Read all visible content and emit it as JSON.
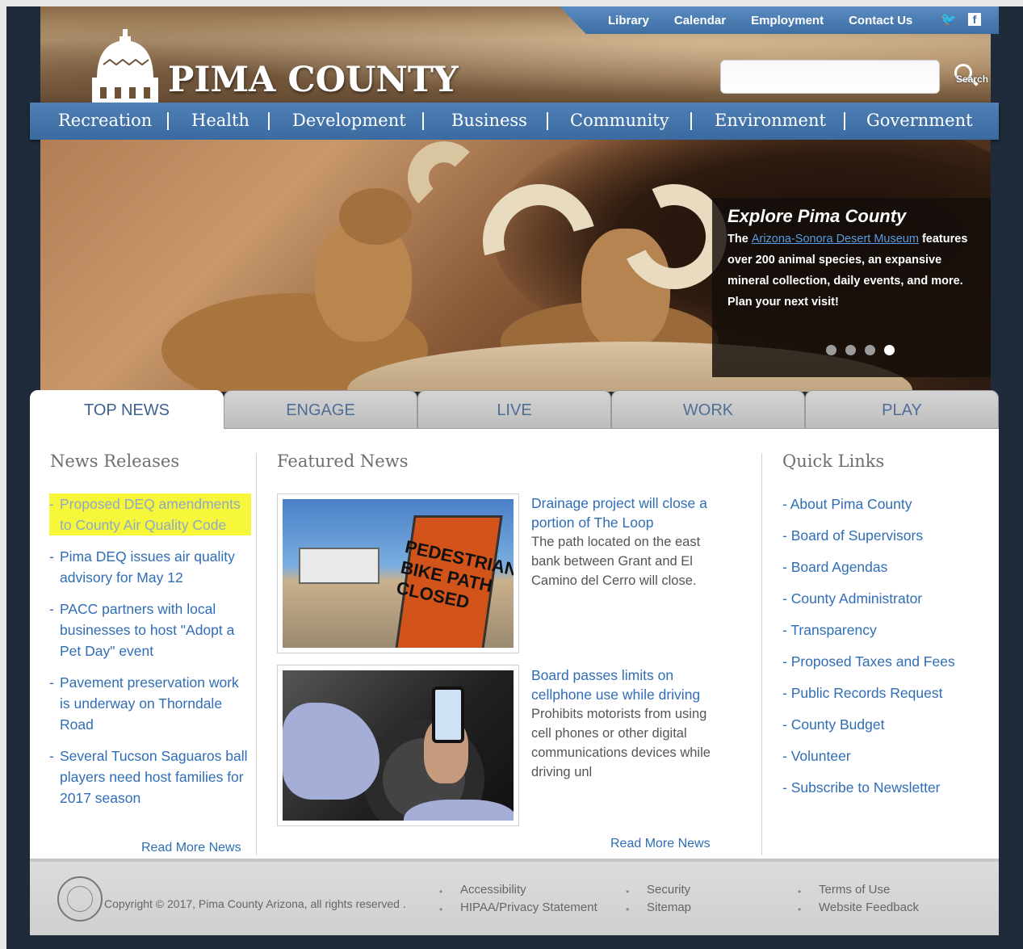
{
  "utility_nav": [
    "Library",
    "Calendar",
    "Employment",
    "Contact Us"
  ],
  "logo_text": "PIMA COUNTY",
  "search": {
    "placeholder": "",
    "button_label": "Search"
  },
  "main_nav": [
    "Recreation",
    "Health",
    "Development",
    "Business",
    "Community",
    "Environment",
    "Government"
  ],
  "hero": {
    "title": "Explore Pima County",
    "text_prefix": "The ",
    "link_text": "Arizona-Sonora Desert Museum",
    "text_suffix": " features over 200 animal species, an expansive mineral collection, daily events, and more. Plan your next visit!",
    "slide_count": 4,
    "active_slide": 4
  },
  "tabs": [
    "TOP NEWS",
    "ENGAGE",
    "LIVE",
    "WORK",
    "PLAY"
  ],
  "active_tab": "TOP NEWS",
  "news_releases": {
    "heading": "News Releases",
    "items": [
      "Proposed DEQ amendments to County Air Quality Code",
      "Pima DEQ issues air quality advisory for May 12",
      "PACC partners with local businesses to host \"Adopt a Pet Day\" event",
      "Pavement preservation work is underway on Thorndale Road",
      "Several Tucson Saguaros ball players need host families for 2017 season"
    ],
    "read_more": "Read More News"
  },
  "featured_news": {
    "heading": "Featured News",
    "items": [
      {
        "title": "Drainage project will close a portion of The Loop",
        "description": "The path located on the east bank between Grant and El Camino del Cerro will close.",
        "image_text": "PEDESTRIAN BIKE PATH CLOSED"
      },
      {
        "title": "Board passes limits on cellphone use while driving",
        "description": "Prohibits motorists from using cell phones or other digital communications devices while driving unl"
      }
    ],
    "read_more": "Read More News"
  },
  "quick_links": {
    "heading": "Quick Links",
    "items": [
      "About Pima County",
      "Board of Supervisors",
      "Board Agendas",
      "County Administrator",
      "Transparency",
      "Proposed Taxes and Fees",
      "Public Records Request",
      "County Budget",
      "Volunteer",
      "Subscribe to Newsletter"
    ]
  },
  "footer": {
    "copyright": "Copyright © 2017, Pima County Arizona, all rights reserved .",
    "col1": [
      "Accessibility",
      "HIPAA/Privacy Statement"
    ],
    "col2": [
      "Security",
      "Sitemap"
    ],
    "col3": [
      "Terms of Use",
      "Website Feedback"
    ]
  },
  "colors": {
    "nav_blue": "#3e6ea3",
    "link_blue": "#2f6db5",
    "highlight": "#f6f63a"
  }
}
